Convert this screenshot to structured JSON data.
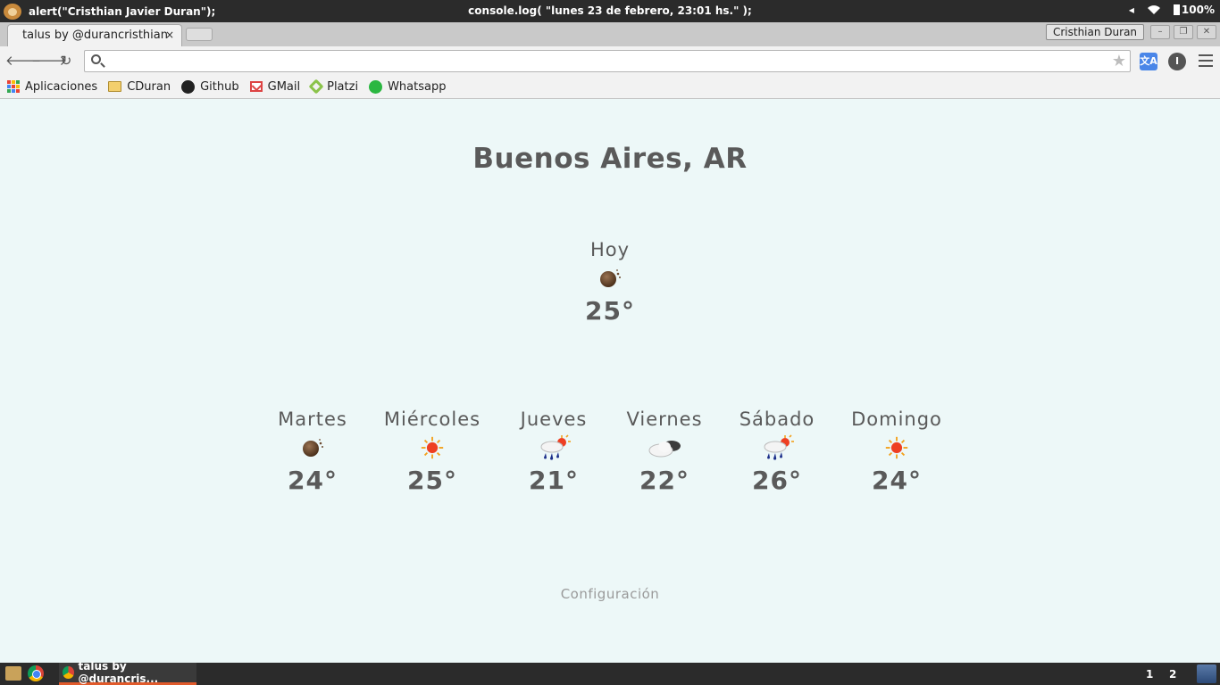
{
  "system_bar": {
    "left_text": "alert(\"Cristhian Javier Duran\");",
    "center_text": "console.log( \"lunes 23 de febrero, 23:01 hs.\" );",
    "battery": "100%"
  },
  "browser": {
    "tab_title": "talus by @durancristhian",
    "tab_close": "×",
    "profile_name": "Cristhian Duran",
    "address": "",
    "bookmarks": [
      {
        "label": "Aplicaciones",
        "icon": "apps-grid-icon"
      },
      {
        "label": "CDuran",
        "icon": "folder-icon"
      },
      {
        "label": "Github",
        "icon": "github-icon"
      },
      {
        "label": "GMail",
        "icon": "gmail-icon"
      },
      {
        "label": "Platzi",
        "icon": "platzi-icon"
      },
      {
        "label": "Whatsapp",
        "icon": "whatsapp-icon"
      }
    ]
  },
  "weather": {
    "city": "Buenos Aires, AR",
    "today": {
      "label": "Hoy",
      "temp": "25°",
      "icon": "moon-icon"
    },
    "forecast": [
      {
        "day": "Martes",
        "temp": "24°",
        "icon": "moon-icon"
      },
      {
        "day": "Miércoles",
        "temp": "25°",
        "icon": "sun-icon"
      },
      {
        "day": "Jueves",
        "temp": "21°",
        "icon": "rain-sun-icon"
      },
      {
        "day": "Viernes",
        "temp": "22°",
        "icon": "cloud-icon"
      },
      {
        "day": "Sábado",
        "temp": "26°",
        "icon": "rain-sun-icon"
      },
      {
        "day": "Domingo",
        "temp": "24°",
        "icon": "sun-icon"
      }
    ],
    "config_link": "Configuración"
  },
  "taskbar": {
    "task_label": "talus by @durancris...",
    "workspaces": [
      "1",
      "2"
    ]
  },
  "colors": {
    "page_bg": "#edf8f8",
    "text": "#5a5a5a",
    "sun": "#f0482a",
    "moon": "#6b4a30"
  }
}
